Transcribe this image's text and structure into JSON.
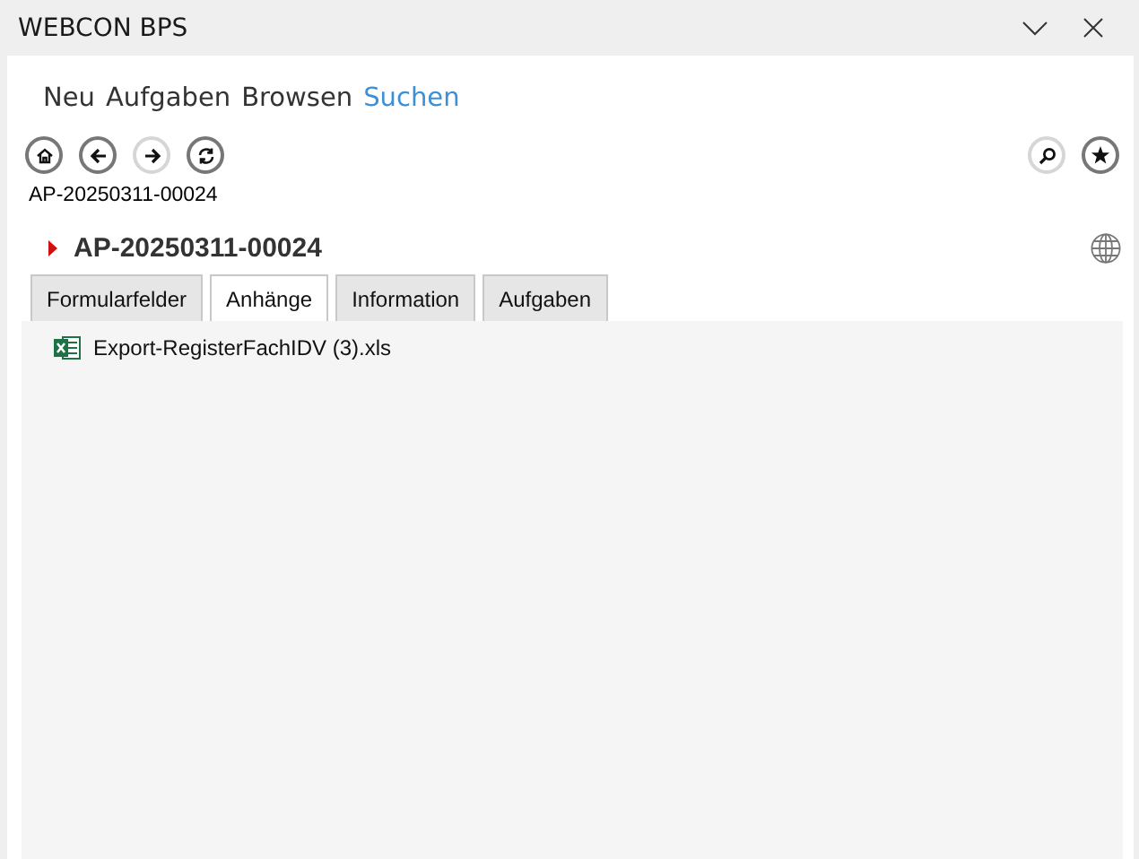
{
  "window": {
    "title": "WEBCON BPS"
  },
  "menu": [
    {
      "label": "Neu",
      "selected": false
    },
    {
      "label": "Aufgaben",
      "selected": false
    },
    {
      "label": "Browsen",
      "selected": false
    },
    {
      "label": "Suchen",
      "selected": true
    }
  ],
  "toolbar_left": [
    {
      "kind": "home",
      "disabled": false
    },
    {
      "kind": "back",
      "disabled": false
    },
    {
      "kind": "forward",
      "disabled": true
    },
    {
      "kind": "refresh",
      "disabled": false
    }
  ],
  "toolbar_right": [
    {
      "kind": "search",
      "disabled": true
    },
    {
      "kind": "star",
      "disabled": false
    }
  ],
  "breadcrumb": "AP-20250311-00024",
  "heading": "AP-20250311-00024",
  "tabs": [
    {
      "label": "Formularfelder",
      "selected": false
    },
    {
      "label": "Anhänge",
      "selected": true
    },
    {
      "label": "Information",
      "selected": false
    },
    {
      "label": "Aufgaben",
      "selected": false
    }
  ],
  "attachments": [
    {
      "name": "Export-RegisterFachIDV (3).xls"
    }
  ]
}
